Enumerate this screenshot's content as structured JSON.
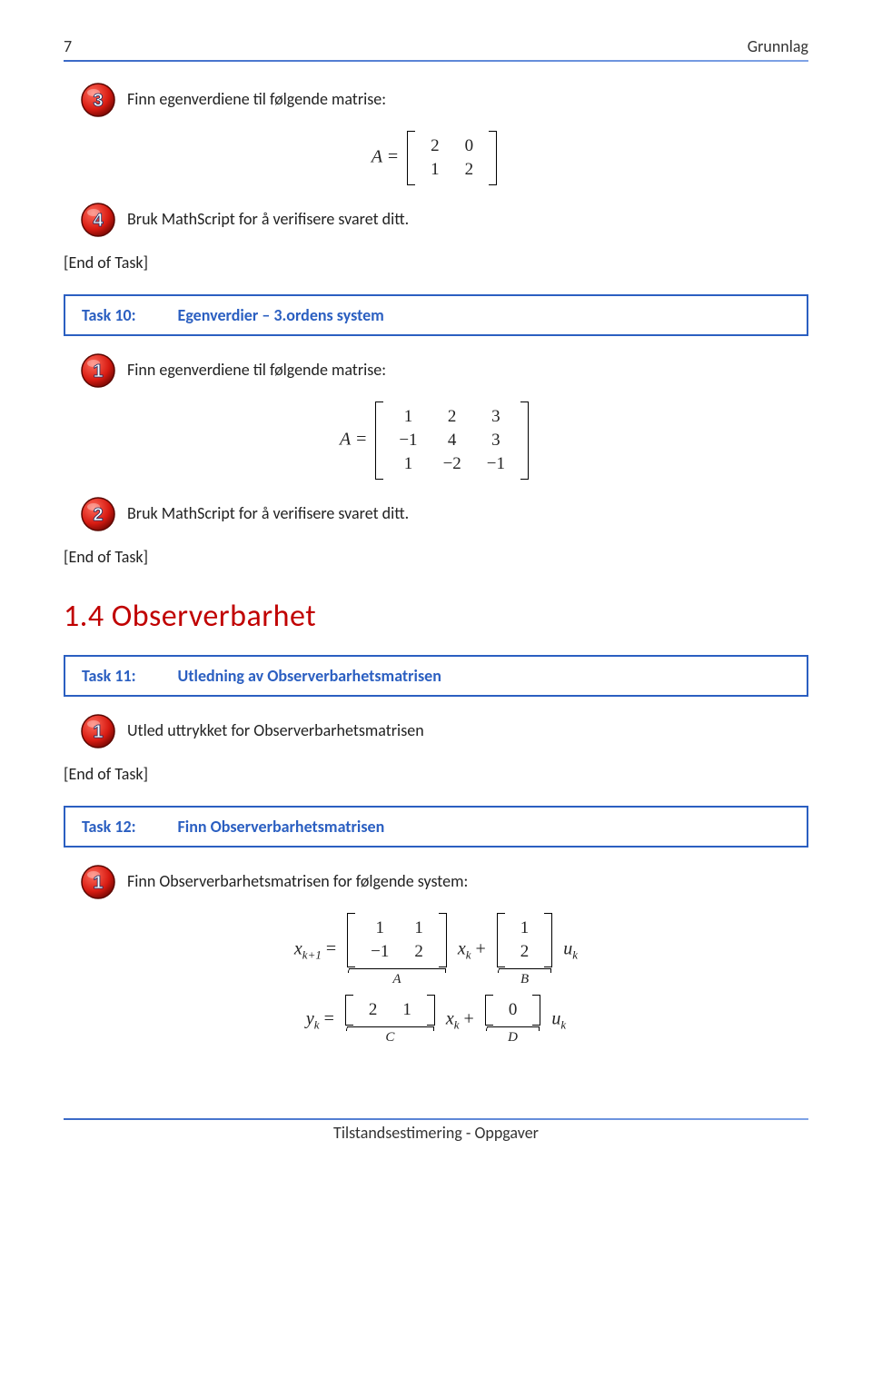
{
  "header": {
    "page_number": "7",
    "section": "Grunnlag"
  },
  "footer": {
    "text": "Tilstandsestimering - Oppgaver"
  },
  "end_of_task": "[End of Task]",
  "intro": {
    "item3_text": "Finn egenverdiene til følgende matrise:",
    "item4_text": "Bruk MathScript for å verifisere svaret ditt.",
    "matrix_lhs": "A =",
    "matrix_rows": [
      [
        "2",
        "0"
      ],
      [
        "1",
        "2"
      ]
    ]
  },
  "task10": {
    "id": "Task 10:",
    "name": "Egenverdier – 3.ordens system",
    "item1_text": "Finn egenverdiene til følgende matrise:",
    "matrix_lhs": "A =",
    "matrix_rows": [
      [
        "1",
        "2",
        "3"
      ],
      [
        "−1",
        "4",
        "3"
      ],
      [
        "1",
        "−2",
        "−1"
      ]
    ],
    "item2_text": "Bruk MathScript for å verifisere svaret ditt."
  },
  "heading": {
    "number": "1.4",
    "title": "Observerbarhet"
  },
  "task11": {
    "id": "Task 11:",
    "name": "Utledning av Observerbarhetsmatrisen",
    "item1_text": "Utled uttrykket for Observerbarhetsmatrisen"
  },
  "task12": {
    "id": "Task 12:",
    "name": "Finn Observerbarhetsmatrisen",
    "item1_text": "Finn Observerbarhetsmatrisen for følgende system:",
    "eq1": {
      "lhs_var": "x",
      "lhs_sub": "k+1",
      "eq": " = ",
      "A_rows": [
        [
          "1",
          "1"
        ],
        [
          "−1",
          "2"
        ]
      ],
      "A_label": "A",
      "mid_var": "x",
      "mid_sub": "k",
      "plus": " + ",
      "B_rows": [
        [
          "1"
        ],
        [
          "2"
        ]
      ],
      "B_label": "B",
      "end_var": "u",
      "end_sub": "k"
    },
    "eq2": {
      "lhs_var": "y",
      "lhs_sub": "k",
      "eq": " = ",
      "C_rows": [
        [
          "2",
          "1"
        ]
      ],
      "C_label": "C",
      "mid_var": "x",
      "mid_sub": "k",
      "plus": " + ",
      "D_rows": [
        [
          "0"
        ]
      ],
      "D_label": "D",
      "end_var": "u",
      "end_sub": "k"
    }
  },
  "chart_data": {
    "type": "table",
    "matrices": {
      "A_2x2_task_intro": [
        [
          2,
          0
        ],
        [
          1,
          2
        ]
      ],
      "A_3x3_task10": [
        [
          1,
          2,
          3
        ],
        [
          -1,
          4,
          3
        ],
        [
          1,
          -2,
          -1
        ]
      ],
      "task12_A": [
        [
          1,
          1
        ],
        [
          -1,
          2
        ]
      ],
      "task12_B": [
        [
          1
        ],
        [
          2
        ]
      ],
      "task12_C": [
        [
          2,
          1
        ]
      ],
      "task12_D": [
        [
          0
        ]
      ]
    }
  }
}
